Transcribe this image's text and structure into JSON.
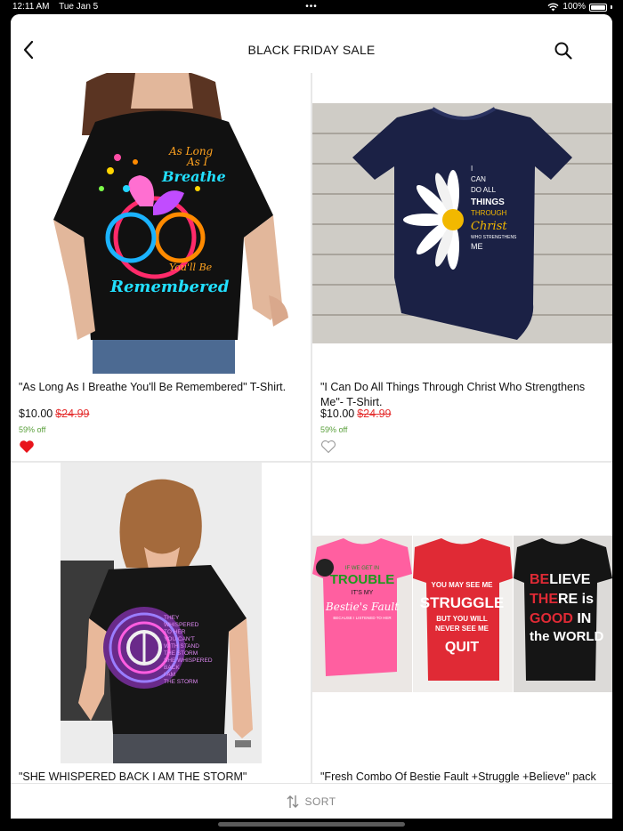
{
  "status": {
    "time": "12:11 AM",
    "date": "Tue Jan 5",
    "battery": "100%",
    "wifi_icon": "wifi-icon",
    "battery_icon": "battery-icon"
  },
  "header": {
    "title": "BLACK FRIDAY SALE",
    "back_icon": "chevron-left-icon",
    "search_icon": "search-icon"
  },
  "products": [
    {
      "name": "\"As Long As I Breathe You'll Be Remembered\" T-Shirt.",
      "price": "$10.00",
      "old_price": "$24.99",
      "discount": "59% off",
      "favorited": true,
      "image_text": [
        "As Long",
        "As I",
        "Breathe",
        "You'll Be",
        "Remembered"
      ]
    },
    {
      "name": "\"I Can Do All Things Through Christ Who Strengthens Me\"- T-Shirt.",
      "price": "$10.00",
      "old_price": "$24.99",
      "discount": "59% off",
      "favorited": false,
      "image_text": [
        "I",
        "CAN",
        "DO ALL",
        "THINGS",
        "THROUGH",
        "Christ",
        "WHO STRENGTHENS",
        "ME"
      ]
    },
    {
      "name": "\"SHE WHISPERED BACK I AM THE STORM\"",
      "image_text": [
        "THEY",
        "WHISPERED",
        "TO HER",
        "YOU CAN'T",
        "WITH STAND",
        "THE STORM",
        "SHE WHISPERED",
        "BACK",
        "I AM",
        "THE STORM"
      ]
    },
    {
      "name": "\"Fresh Combo Of Bestie Fault +Struggle +Believe\" pack",
      "image_text": {
        "shirt1": [
          "IF WE GET IN",
          "TROUBLE",
          "IT'S MY",
          "Bestie's Fault",
          "BECAUSE I LISTENED TO HER"
        ],
        "shirt2": [
          "YOU MAY SEE ME",
          "STRUGGLE",
          "BUT YOU WILL",
          "NEVER SEE ME",
          "QUIT"
        ],
        "shirt3": [
          "BELIEVE",
          "THERE is",
          "GOOD IN",
          "the WORLD"
        ]
      }
    }
  ],
  "footer": {
    "sort_label": "SORT",
    "sort_icon": "sort-arrows-icon"
  },
  "colors": {
    "sale_red": "#e53030",
    "discount_green": "#5aa03c",
    "heart_red": "#e8141b"
  }
}
